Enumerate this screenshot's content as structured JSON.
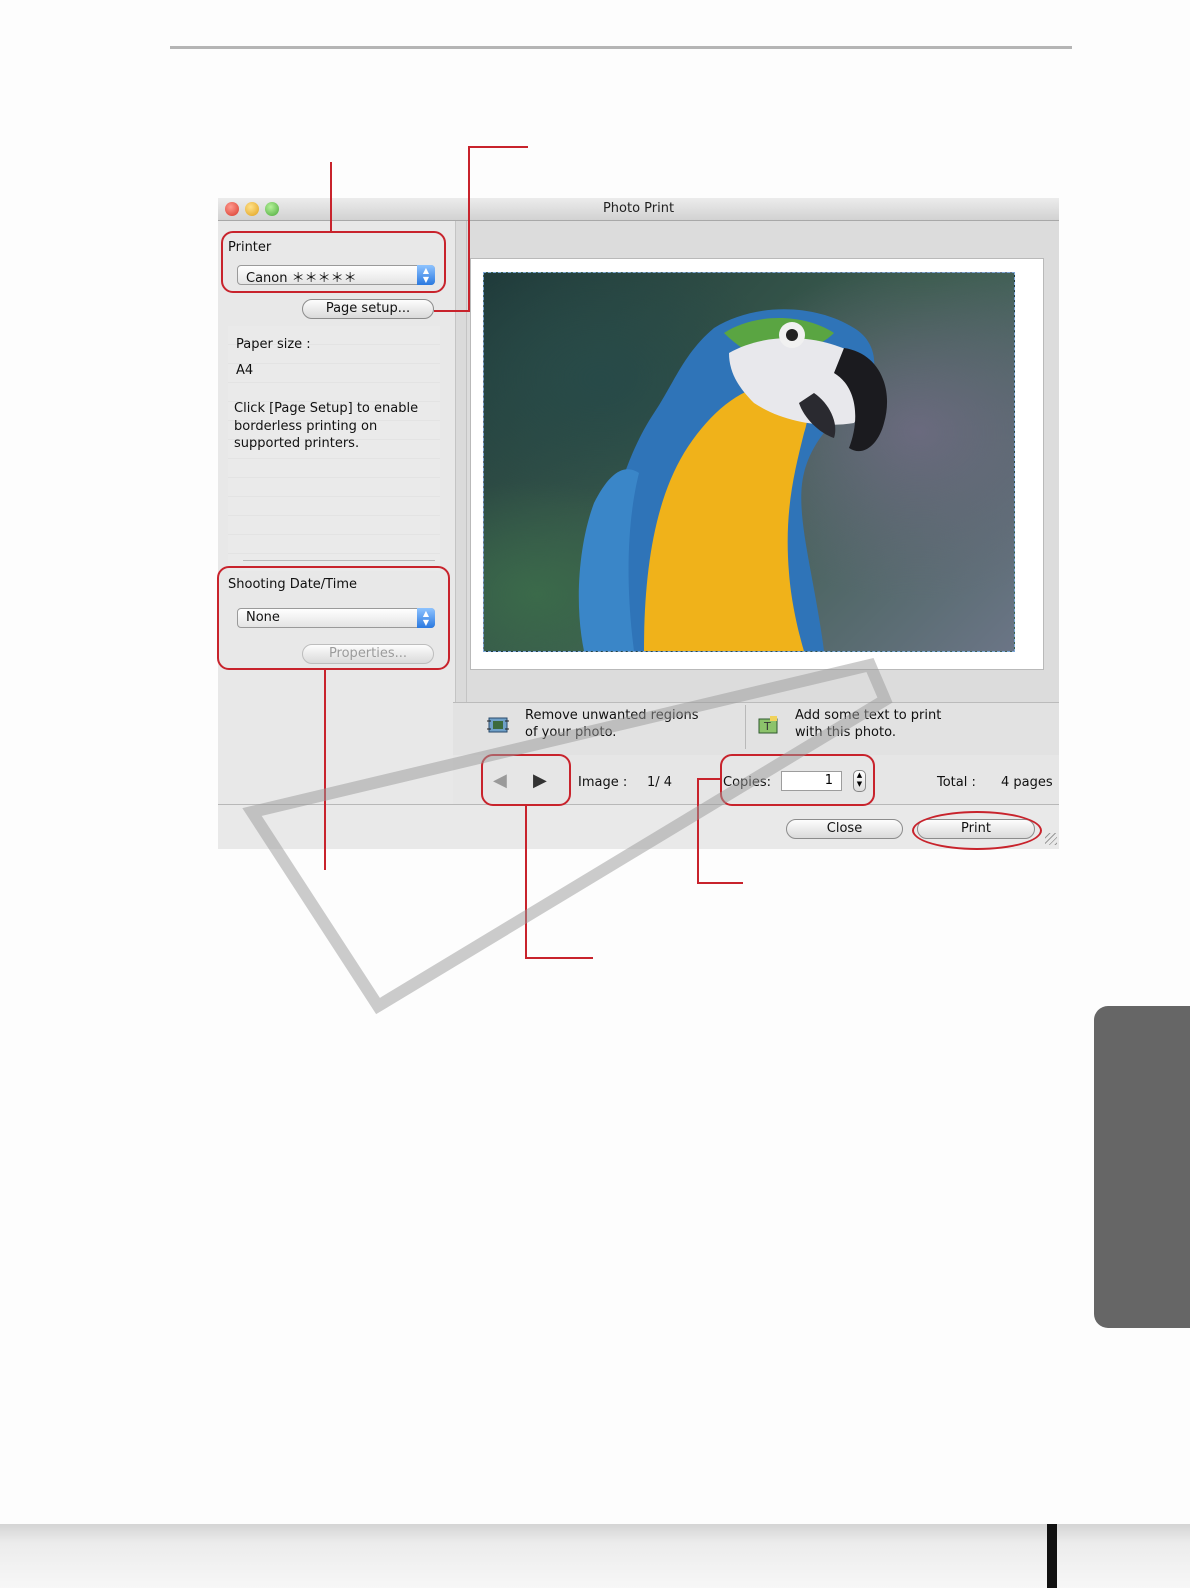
{
  "window": {
    "title": "Photo Print"
  },
  "left_panel": {
    "printer_label": "Printer",
    "printer_value": "Canon ＊＊＊＊＊",
    "page_setup_button": "Page setup...",
    "paper_size_label": "Paper size :",
    "paper_size_value": "A4",
    "hint_line1": "Click [Page Setup] to enable",
    "hint_line2": "borderless printing on",
    "hint_line3": "supported printers.",
    "shooting_label": "Shooting Date/Time",
    "shooting_value": "None",
    "properties_button": "Properties..."
  },
  "tools": {
    "trim_line1": "Remove unwanted regions",
    "trim_line2": "of your photo.",
    "trim_icon": "trim-icon",
    "text_line1": "Add some text to print",
    "text_line2": "with this photo.",
    "text_icon": "text-insert-icon"
  },
  "navigation": {
    "prev_icon": "◀",
    "next_icon": "▶",
    "image_label": "Image :",
    "image_value": "1/ 4",
    "copies_label": "Copies:",
    "copies_value": "1",
    "total_label": "Total :",
    "total_value": "4 pages"
  },
  "buttons": {
    "close": "Close",
    "print": "Print"
  },
  "colors": {
    "callout": "#c8232c",
    "select_arrow": "#2b79e0",
    "side_tab": "#666666"
  }
}
